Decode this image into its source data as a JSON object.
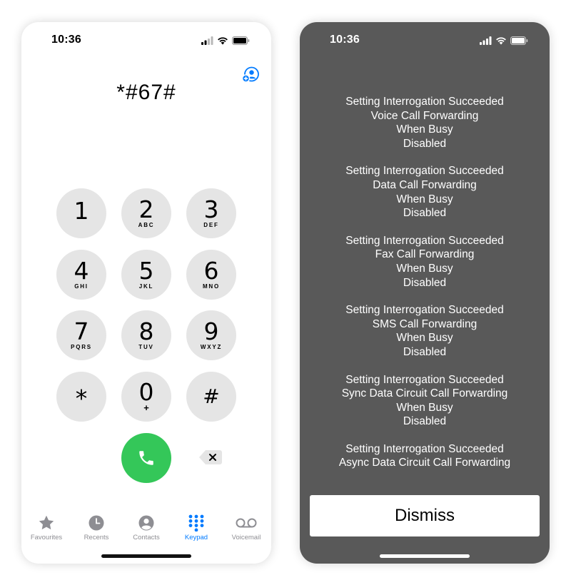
{
  "colors": {
    "accent": "#007aff",
    "call_green": "#34c759",
    "key_gray": "#e5e5e5",
    "dialog_gray": "#595959"
  },
  "dialer": {
    "status_time": "10:36",
    "number": "*#67#",
    "add_contact_icon": "add-contact-icon",
    "keys": [
      {
        "digit": "1",
        "letters": ""
      },
      {
        "digit": "2",
        "letters": "ABC"
      },
      {
        "digit": "3",
        "letters": "DEF"
      },
      {
        "digit": "4",
        "letters": "GHI"
      },
      {
        "digit": "5",
        "letters": "JKL"
      },
      {
        "digit": "6",
        "letters": "MNO"
      },
      {
        "digit": "7",
        "letters": "PQRS"
      },
      {
        "digit": "8",
        "letters": "TUV"
      },
      {
        "digit": "9",
        "letters": "WXYZ"
      },
      {
        "digit": "*",
        "letters": ""
      },
      {
        "digit": "0",
        "letters": "+"
      },
      {
        "digit": "#",
        "letters": ""
      }
    ],
    "tabs": [
      {
        "label": "Favourites",
        "icon": "star-icon"
      },
      {
        "label": "Recents",
        "icon": "clock-icon"
      },
      {
        "label": "Contacts",
        "icon": "person-icon"
      },
      {
        "label": "Keypad",
        "icon": "keypad-icon"
      },
      {
        "label": "Voicemail",
        "icon": "voicemail-icon"
      }
    ],
    "active_tab": "Keypad"
  },
  "result": {
    "status_time": "10:36",
    "messages": [
      {
        "lines": [
          "Setting Interrogation Succeeded",
          "Voice Call Forwarding",
          "When Busy",
          "Disabled"
        ]
      },
      {
        "lines": [
          "Setting Interrogation Succeeded",
          "Data Call Forwarding",
          "When Busy",
          "Disabled"
        ]
      },
      {
        "lines": [
          "Setting Interrogation Succeeded",
          "Fax Call Forwarding",
          "When Busy",
          "Disabled"
        ]
      },
      {
        "lines": [
          "Setting Interrogation Succeeded",
          "SMS Call Forwarding",
          "When Busy",
          "Disabled"
        ]
      },
      {
        "lines": [
          "Setting Interrogation Succeeded",
          "Sync Data Circuit Call Forwarding",
          "When Busy",
          "Disabled"
        ]
      },
      {
        "lines": [
          "Setting Interrogation Succeeded",
          "Async Data Circuit Call Forwarding"
        ]
      }
    ],
    "dismiss_label": "Dismiss"
  }
}
